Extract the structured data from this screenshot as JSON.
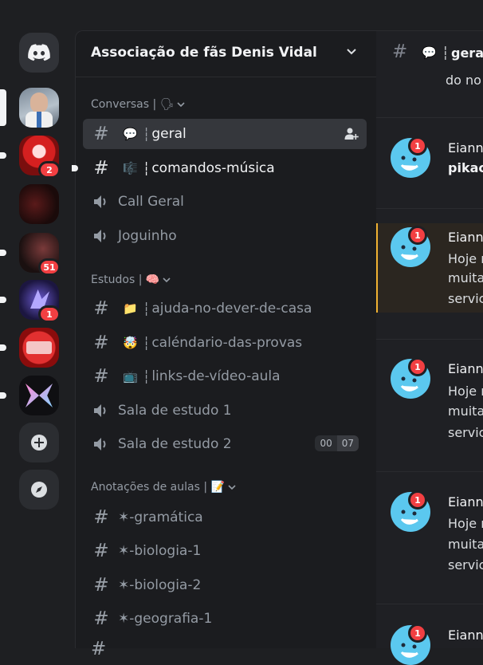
{
  "servers": [
    {
      "name": "discord-home"
    },
    {
      "name": "server-denis-vidal",
      "selected": true
    },
    {
      "name": "server-2",
      "badge": "2"
    },
    {
      "name": "server-3"
    },
    {
      "name": "server-4",
      "badge": "51"
    },
    {
      "name": "server-5",
      "badge": "1"
    },
    {
      "name": "server-6"
    },
    {
      "name": "server-7"
    }
  ],
  "server_header": {
    "name": "Associação de fãs Denis Vidal"
  },
  "categories": {
    "conversas": {
      "label": "Conversas | 🗣"
    },
    "estudos": {
      "label": "Estudos | 🧠"
    },
    "anotacoes": {
      "label": "Anotações de aulas | 📝"
    }
  },
  "channels": {
    "geral": {
      "emoji": "💬",
      "sep": "┆",
      "name": "geral"
    },
    "comandos": {
      "emoji": "🎼",
      "sep": "┆",
      "name": "comandos-música"
    },
    "call_geral": {
      "name": "Call Geral"
    },
    "joguinho": {
      "name": "Joguinho"
    },
    "ajuda": {
      "emoji": "📁",
      "sep": "┆",
      "name": "ajuda-no-dever-de-casa"
    },
    "calendario": {
      "emoji": "🤯",
      "sep": "┆",
      "name": "caléndario-das-provas"
    },
    "links": {
      "emoji": "📺",
      "sep": "┆",
      "name": "links-de-vídeo-aula"
    },
    "sala1": {
      "name": "Sala de estudo 1"
    },
    "sala2": {
      "name": "Sala de estudo 2",
      "timer_a": "00",
      "timer_b": "07"
    },
    "gramatica": {
      "name": "✶-gramática"
    },
    "biologia1": {
      "name": "✶-biologia-1"
    },
    "biologia2": {
      "name": "✶-biologia-2"
    },
    "geografia1": {
      "name": "✶-geografia-1"
    }
  },
  "main": {
    "channel_name": "gera",
    "top_text": "do no",
    "messages": [
      {
        "author": "Eiann",
        "line1": "pikac",
        "badge": "1"
      },
      {
        "author": "Eiann",
        "line1": "Hoje r",
        "line2": "muita",
        "line3": "servic",
        "badge": "1"
      },
      {
        "author": "Eiann",
        "line1": "Hoje r",
        "line2": "muita",
        "line3": "servic",
        "badge": "1"
      },
      {
        "author": "Eiann",
        "line1": "Hoje r",
        "line2": "muita",
        "line3": "servic",
        "badge": "1"
      },
      {
        "author": "Eiann",
        "badge": "1"
      }
    ]
  },
  "colors": {
    "accent": "#5865f2",
    "badge": "#f23f42",
    "avatar": "#5bc8ef",
    "highlight": "#f0b232"
  }
}
